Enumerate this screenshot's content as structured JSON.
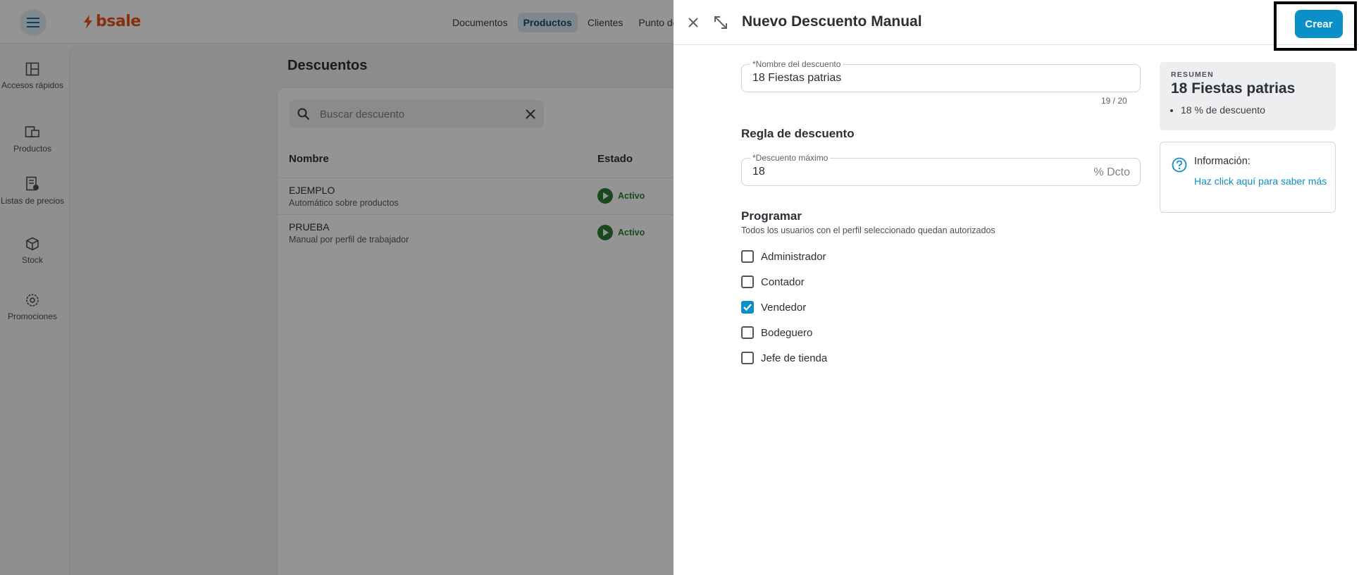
{
  "app": {
    "logo_text": "bsale",
    "nav": [
      {
        "label": "Documentos",
        "active": false
      },
      {
        "label": "Productos",
        "active": true
      },
      {
        "label": "Clientes",
        "active": false
      },
      {
        "label": "Punto de",
        "active": false
      }
    ],
    "sidebar": [
      {
        "label": "Accesos rápidos",
        "icon": "layout-icon"
      },
      {
        "label": "Productos",
        "icon": "products-icon"
      },
      {
        "label": "Listas de precios",
        "icon": "price-list-icon"
      },
      {
        "label": "Stock",
        "icon": "box-icon"
      },
      {
        "label": "Promociones",
        "icon": "promo-icon"
      }
    ],
    "page_title": "Descuentos",
    "search_placeholder": "Buscar descuento",
    "table": {
      "headers": {
        "name": "Nombre",
        "status": "Estado"
      },
      "rows": [
        {
          "name": "EJEMPLO",
          "sub": "Automático sobre productos",
          "status": "Activo"
        },
        {
          "name": "PRUEBA",
          "sub": "Manual por perfil de trabajador",
          "status": "Activo"
        }
      ]
    }
  },
  "drawer": {
    "title": "Nuevo Descuento Manual",
    "create_label": "Crear",
    "name_field": {
      "label": "*Nombre del descuento",
      "value": "18 Fiestas patrias",
      "counter": "19 / 20"
    },
    "rule_section": "Regla de descuento",
    "max_field": {
      "label": "*Descuento máximo",
      "value": "18",
      "suffix": "% Dcto"
    },
    "schedule": {
      "title": "Programar",
      "subtitle": "Todos los usuarios con el perfil seleccionado quedan autorizados",
      "profiles": [
        {
          "label": "Administrador",
          "checked": false
        },
        {
          "label": "Contador",
          "checked": false
        },
        {
          "label": "Vendedor",
          "checked": true
        },
        {
          "label": "Bodeguero",
          "checked": false
        },
        {
          "label": "Jefe de tienda",
          "checked": false
        }
      ]
    },
    "summary": {
      "tag": "RESUMEN",
      "title": "18 Fiestas patrias",
      "bullet": "18 % de descuento"
    },
    "info": {
      "title": "Información:",
      "link": "Haz click aquí para saber más"
    }
  },
  "colors": {
    "accent": "#0a8fc9",
    "brand": "#e8531d",
    "active_status": "#2e7d32"
  }
}
